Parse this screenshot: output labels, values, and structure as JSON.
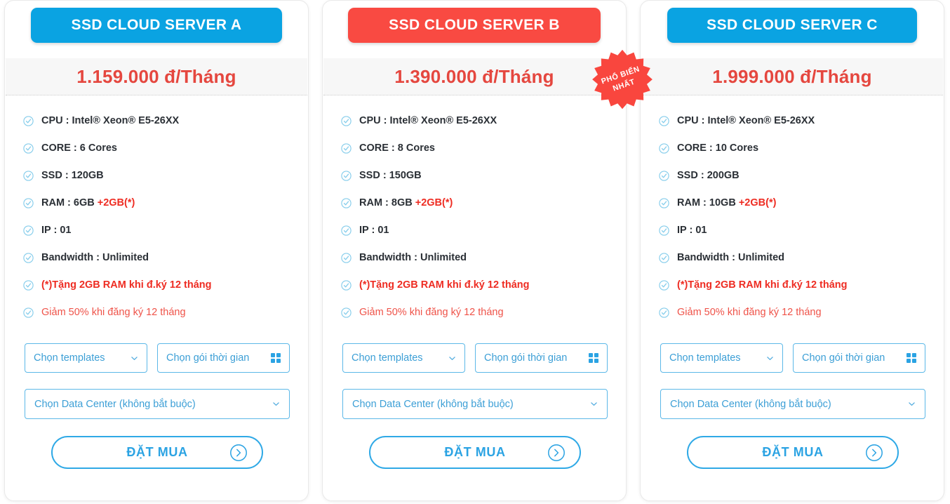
{
  "colors": {
    "blue": "#0aa3e2",
    "red": "#f94a42",
    "price_red": "#e5473f",
    "accent_red": "#ee2c22",
    "soft_red": "#ef5349",
    "select_blue": "#3c9fd6",
    "button_blue": "#2ba3e3",
    "band_bg": "#f7f7f7"
  },
  "badge": {
    "line1": "PHỔ BIẾN",
    "line2": "NHẤT"
  },
  "controls": {
    "templates_label": "Chọn templates",
    "time_label": "Chọn gói thời gian",
    "datacenter_label": "Chọn Data Center (không bắt buộc)",
    "order_label": "ĐẶT MUA"
  },
  "plans": [
    {
      "id": "a",
      "title": "SSD CLOUD SERVER A",
      "header_color": "#0aa3e2",
      "price": "1.159.000 đ/Tháng",
      "popular": false,
      "features": [
        {
          "text": "CPU : Intel® Xeon® E5-26XX",
          "style": "normal"
        },
        {
          "text": "CORE : 6 Cores",
          "style": "normal"
        },
        {
          "text": "SSD : 120GB",
          "style": "normal"
        },
        {
          "text": "RAM : 6GB ",
          "highlight": "+2GB(*)",
          "style": "normal"
        },
        {
          "text": "IP : 01",
          "style": "normal"
        },
        {
          "text": "Bandwidth : Unlimited",
          "style": "normal"
        },
        {
          "text": "(*)Tặng 2GB RAM khi đ.ký 12 tháng",
          "style": "red"
        },
        {
          "text": "Giảm 50% khi đăng ký 12 tháng",
          "style": "soft"
        }
      ]
    },
    {
      "id": "b",
      "title": "SSD CLOUD SERVER B",
      "header_color": "#f94a42",
      "price": "1.390.000 đ/Tháng",
      "popular": true,
      "features": [
        {
          "text": "CPU : Intel® Xeon® E5-26XX",
          "style": "normal"
        },
        {
          "text": "CORE : 8 Cores",
          "style": "normal"
        },
        {
          "text": "SSD : 150GB",
          "style": "normal"
        },
        {
          "text": "RAM : 8GB ",
          "highlight": "+2GB(*)",
          "style": "normal"
        },
        {
          "text": "IP : 01",
          "style": "normal"
        },
        {
          "text": "Bandwidth : Unlimited",
          "style": "normal"
        },
        {
          "text": "(*)Tặng 2GB RAM khi đ.ký 12 tháng",
          "style": "red"
        },
        {
          "text": "Giảm 50% khi đăng ký 12 tháng",
          "style": "soft"
        }
      ]
    },
    {
      "id": "c",
      "title": "SSD CLOUD SERVER C",
      "header_color": "#0aa3e2",
      "price": "1.999.000 đ/Tháng",
      "popular": false,
      "features": [
        {
          "text": "CPU : Intel® Xeon® E5-26XX",
          "style": "normal"
        },
        {
          "text": "CORE : 10 Cores",
          "style": "normal"
        },
        {
          "text": "SSD : 200GB",
          "style": "normal"
        },
        {
          "text": "RAM : 10GB ",
          "highlight": "+2GB(*)",
          "style": "normal"
        },
        {
          "text": "IP : 01",
          "style": "normal"
        },
        {
          "text": "Bandwidth : Unlimited",
          "style": "normal"
        },
        {
          "text": "(*)Tặng 2GB RAM khi đ.ký 12 tháng",
          "style": "red"
        },
        {
          "text": "Giảm 50% khi đăng ký 12 tháng",
          "style": "soft"
        }
      ]
    }
  ]
}
